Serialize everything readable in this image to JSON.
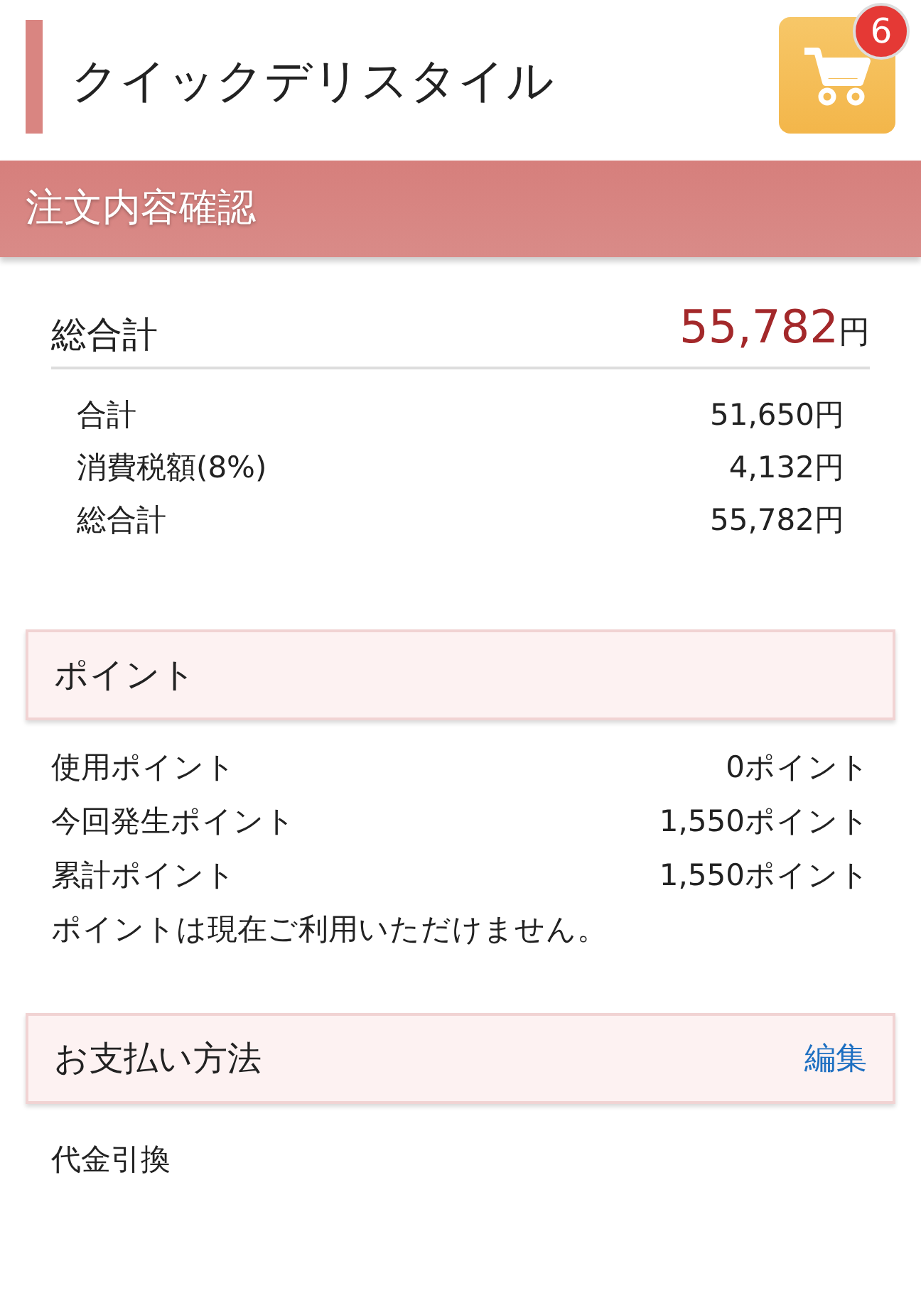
{
  "header": {
    "title": "クイックデリスタイル",
    "cart_count": "6"
  },
  "banner": {
    "title": "注文内容確認"
  },
  "total": {
    "label": "総合計",
    "amount": "55,782",
    "unit": "円"
  },
  "breakdown": [
    {
      "label": "合計",
      "value": "51,650円"
    },
    {
      "label": "消費税額(8%)",
      "value": "4,132円"
    },
    {
      "label": "総合計",
      "value": "55,782円"
    }
  ],
  "points": {
    "title": "ポイント",
    "rows": [
      {
        "label": "使用ポイント",
        "value": "0ポイント"
      },
      {
        "label": "今回発生ポイント",
        "value": "1,550ポイント"
      },
      {
        "label": "累計ポイント",
        "value": "1,550ポイント"
      }
    ],
    "note": "ポイントは現在ご利用いただけません。"
  },
  "payment": {
    "title": "お支払い方法",
    "edit": "編集",
    "method": "代金引換"
  }
}
